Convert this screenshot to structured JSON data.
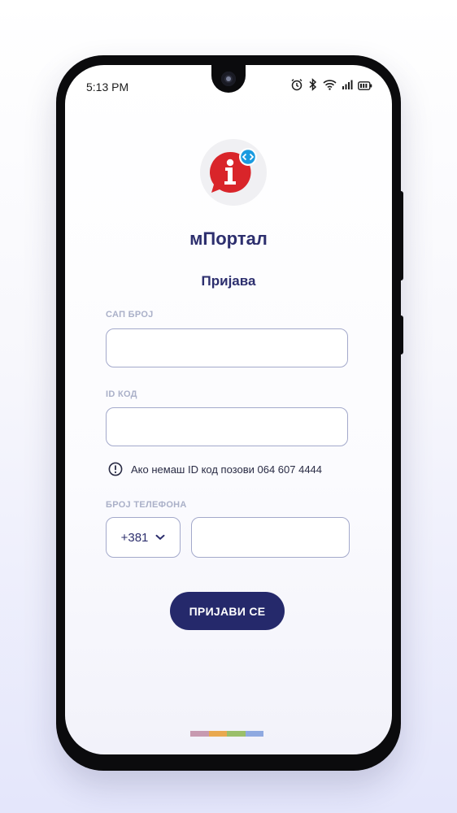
{
  "status_bar": {
    "time": "5:13 PM",
    "icons": [
      "alarm-icon",
      "bluetooth-icon",
      "wifi-icon",
      "signal-icon",
      "battery-icon"
    ]
  },
  "app": {
    "name": "мПортал",
    "logo_icon": "info-chat-bubble-icon"
  },
  "login": {
    "heading": "Пријава",
    "sap_label": "САП БРОЈ",
    "sap_value": "",
    "id_label": "ID КОД",
    "id_value": "",
    "hint": "Ако немаш ID код позови 064 607 4444",
    "phone_label": "БРОЈ ТЕЛЕФОНА",
    "country_code": "+381",
    "phone_value": "",
    "submit_label": "ПРИЈАВИ СЕ"
  },
  "colors": {
    "primary": "#25296b",
    "logo_red": "#d9252a",
    "logo_blue_badge": "#1a9be0",
    "field_border": "#a3a9cb",
    "label": "#aab0c8",
    "accent_bar": [
      "#c79ab0",
      "#e9a94f",
      "#9bbf6a",
      "#8fa9e0"
    ]
  }
}
